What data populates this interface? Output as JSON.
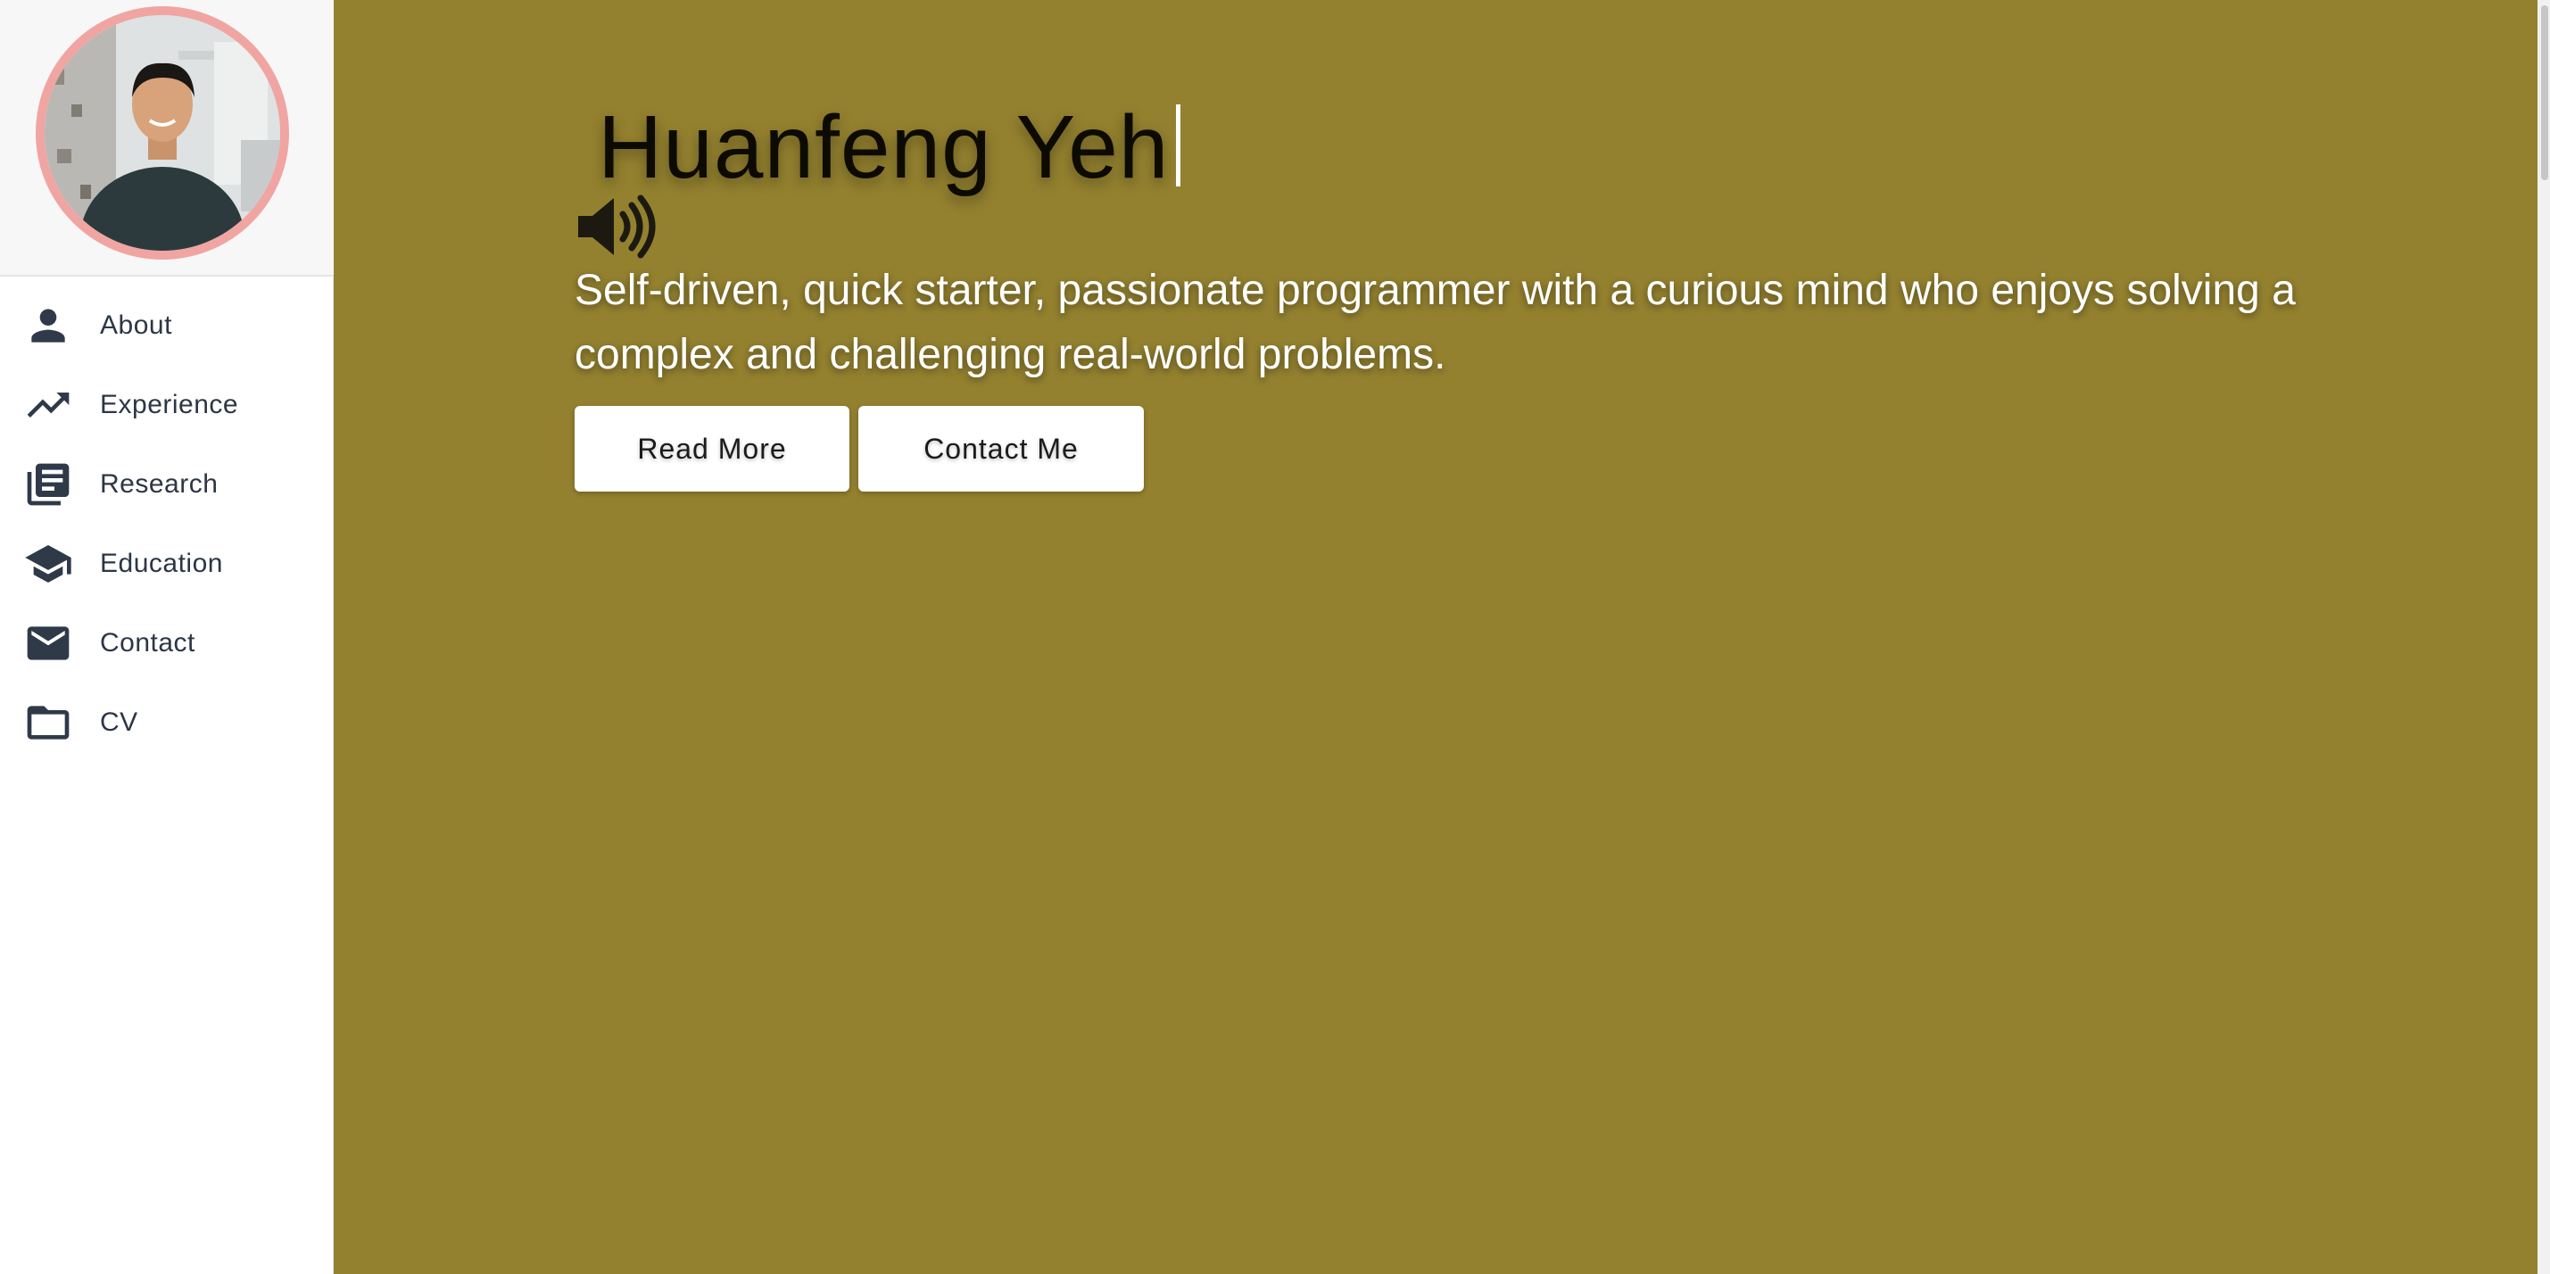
{
  "profile": {
    "avatar_icon": "profile-photo",
    "avatar_ring_color": "#f0a5a2"
  },
  "sidebar": {
    "items": [
      {
        "label": "About",
        "icon": "person-icon"
      },
      {
        "label": "Experience",
        "icon": "trending-up-icon"
      },
      {
        "label": "Research",
        "icon": "library-books-icon"
      },
      {
        "label": "Education",
        "icon": "school-icon"
      },
      {
        "label": "Contact",
        "icon": "mail-icon"
      },
      {
        "label": "CV",
        "icon": "folder-icon"
      }
    ]
  },
  "hero": {
    "title": "Huanfeng Yeh",
    "speaker_icon": "volume-up-icon",
    "tagline": "Self-driven, quick starter, passionate programmer with a curious mind who enjoys solving a complex and challenging real-world problems.",
    "read_more_label": "Read More",
    "contact_label": "Contact Me"
  },
  "colors": {
    "hero_background": "#93812f",
    "sidebar_background": "#ffffff",
    "icon_color": "#2f3a49"
  }
}
